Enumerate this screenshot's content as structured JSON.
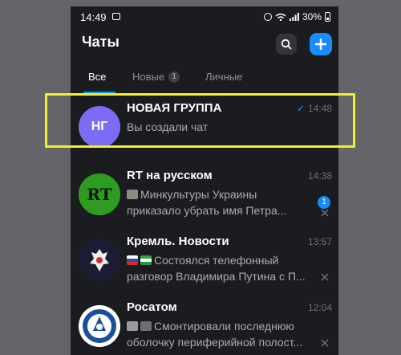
{
  "status_bar": {
    "time": "14:49",
    "battery": "30%"
  },
  "header": {
    "title": "Чаты"
  },
  "tabs": [
    {
      "label": "Все",
      "active": true
    },
    {
      "label": "Новые",
      "badge": "1",
      "active": false
    },
    {
      "label": "Личные",
      "active": false
    }
  ],
  "chats": [
    {
      "name": "НОВАЯ ГРУППА",
      "initials": "НГ",
      "time": "14:48",
      "preview_line1": "Вы создали чат",
      "preview_line2": "",
      "avatar_color": "#7b6cf6"
    },
    {
      "name": "RT на русском",
      "initials": "RT",
      "time": "14:38",
      "preview_line1": "Минкультуры Украины",
      "preview_line2": "приказало убрать имя Петра...",
      "unread": "1",
      "avatar_color": "#37a82a"
    },
    {
      "name": "Кремль. Новости",
      "initials": "",
      "time": "13:57",
      "preview_line1": "Состоялся телефонный",
      "preview_line2": "разговор Владимира Путина с П...",
      "avatar_color": "#1f1f3a"
    },
    {
      "name": "Росатом",
      "initials": "",
      "time": "12:04",
      "preview_line1": "Смонтировали последнюю",
      "preview_line2": "оболочку периферийной полост...",
      "avatar_color": "#ffffff"
    }
  ],
  "colors": {
    "accent": "#1a8cff",
    "highlight": "#f3ef2a",
    "background": "#1b1c20"
  }
}
